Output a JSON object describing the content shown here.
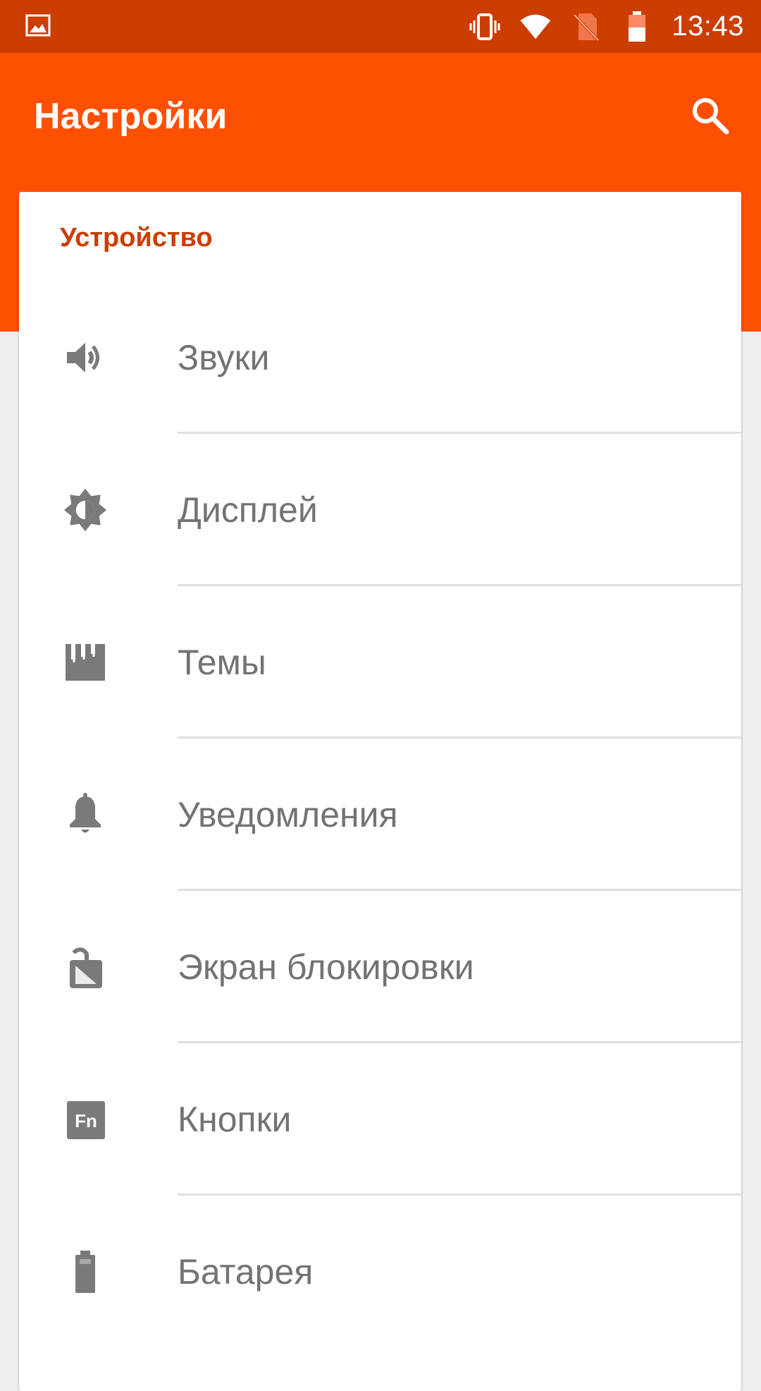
{
  "status_bar": {
    "time": "13:43",
    "icons": [
      "gallery-icon",
      "vibrate-icon",
      "wifi-icon",
      "no-sim-icon",
      "battery-icon"
    ]
  },
  "header": {
    "title": "Настройки",
    "search_icon": "search-icon"
  },
  "section": {
    "title": "Устройство",
    "items": [
      {
        "label": "Звуки",
        "icon": "volume-icon"
      },
      {
        "label": "Дисплей",
        "icon": "brightness-icon"
      },
      {
        "label": "Темы",
        "icon": "themes-icon"
      },
      {
        "label": "Уведомления",
        "icon": "bell-icon"
      },
      {
        "label": "Экран блокировки",
        "icon": "lock-screen-icon"
      },
      {
        "label": "Кнопки",
        "icon": "fn-buttons-icon"
      },
      {
        "label": "Батарея",
        "icon": "battery-icon"
      }
    ]
  },
  "colors": {
    "status_bar": "#cc3d00",
    "app_bar": "#ff4f00",
    "accent_text": "#cc3d00",
    "item_text": "#737373",
    "icon": "#7a7a7a",
    "background": "#eeeeee"
  }
}
